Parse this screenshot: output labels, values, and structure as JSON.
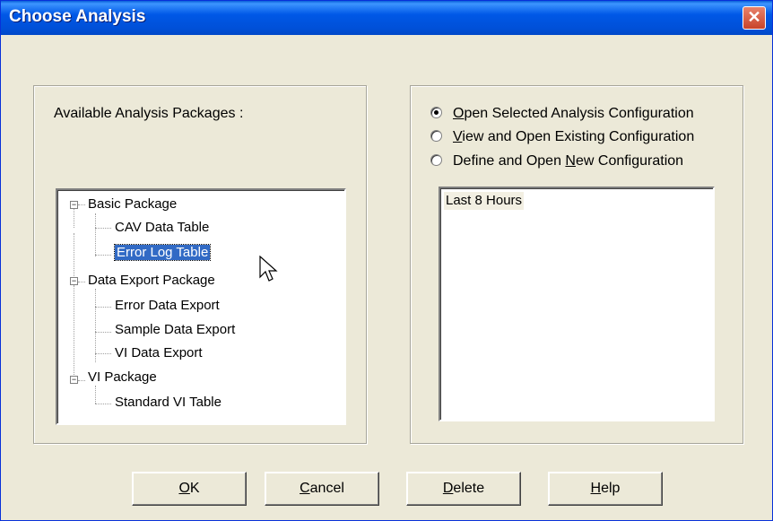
{
  "window": {
    "title": "Choose Analysis",
    "close_glyph": "✕"
  },
  "left": {
    "label": "Available Analysis Packages :",
    "tree": [
      {
        "label": "Basic Package",
        "expander": "−",
        "children": [
          "CAV Data Table",
          "Error Log Table"
        ]
      },
      {
        "label": "Data Export Package",
        "expander": "−",
        "children": [
          "Error Data Export",
          "Sample Data Export",
          "VI Data Export"
        ]
      },
      {
        "label": "VI Package",
        "expander": "−",
        "children": [
          "Standard VI Table"
        ]
      }
    ],
    "selected": "Error Log Table"
  },
  "right": {
    "options": [
      {
        "pre": "",
        "ul": "O",
        "post": "pen Selected Analysis Configuration",
        "checked": true
      },
      {
        "pre": "",
        "ul": "V",
        "post": "iew and Open Existing Configuration",
        "checked": false
      },
      {
        "pre": "Define and Open ",
        "ul": "N",
        "post": "ew Configuration",
        "checked": false
      }
    ],
    "configs": [
      "Last 8 Hours"
    ]
  },
  "buttons": {
    "ok": {
      "ul": "O",
      "post": "K"
    },
    "cancel": {
      "ul": "C",
      "post": "ancel"
    },
    "delete": {
      "ul": "D",
      "post": "elete"
    },
    "help": {
      "ul": "H",
      "post": "elp"
    }
  },
  "colors": {
    "title_bar": "#0058e6",
    "dialog_bg": "#ece9d8",
    "selection": "#316ac5",
    "close_button": "#c8432a"
  }
}
